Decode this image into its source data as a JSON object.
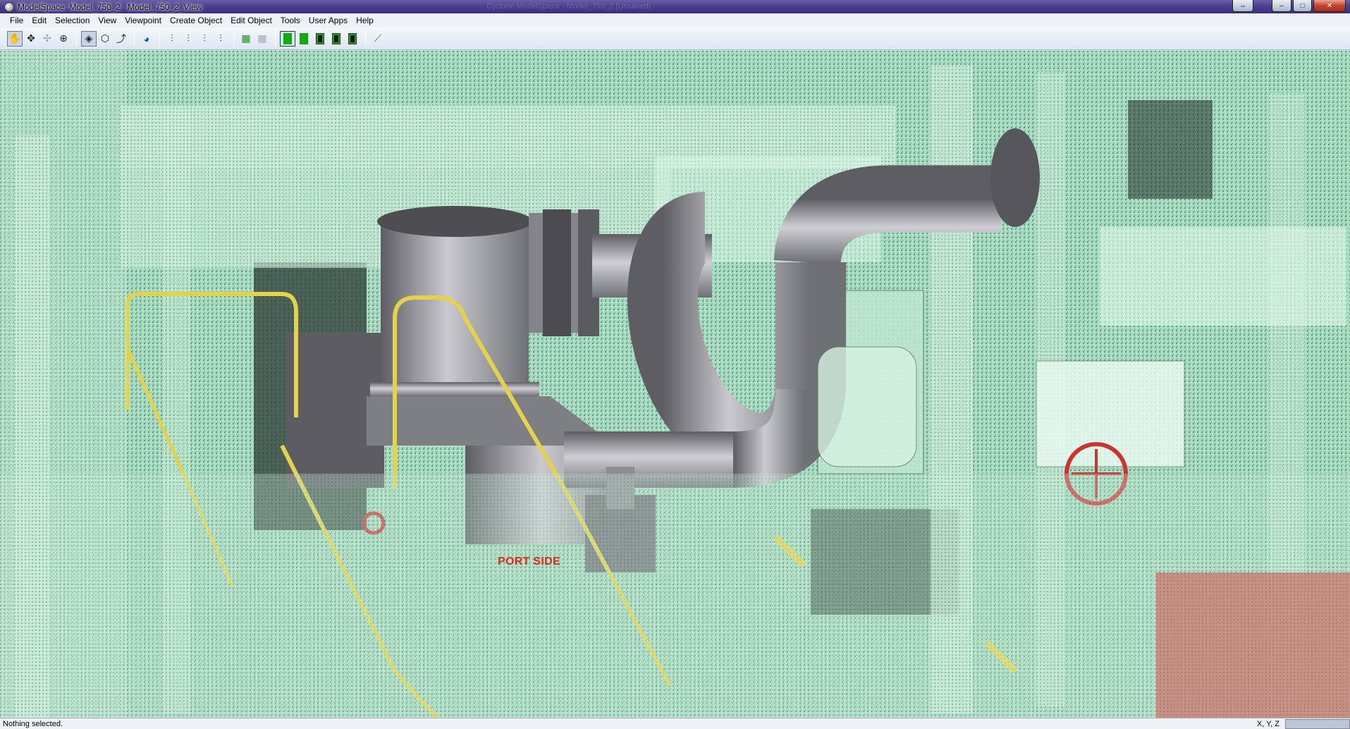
{
  "window": {
    "title": "ModelSpace: Model_750_2 : Model_750_2_View",
    "ghost_text": "Cyclone ModelSpace - Model_750_2 [Unsaved]",
    "buttons": {
      "restore_small": "⇔",
      "minimize": "–",
      "maximize": "□",
      "close": "✕"
    }
  },
  "menu": {
    "items": [
      "File",
      "Edit",
      "Selection",
      "View",
      "Viewpoint",
      "Create Object",
      "Edit Object",
      "Tools",
      "User Apps",
      "Help"
    ]
  },
  "toolbar": {
    "groups": [
      [
        "hand-tool-icon",
        "move-tool-icon",
        "seek-tool-icon",
        "target-tool-icon"
      ],
      [
        "rendered-view-icon",
        "box-view-icon",
        "rotate-axis-icon"
      ],
      [
        "globe-icon"
      ],
      [
        "layer-1-icon",
        "layer-2-icon",
        "layer-3-icon",
        "layer-4-icon"
      ],
      [
        "grid-snap-icon",
        "grid-snap-alt-icon"
      ],
      [
        "green-mode-1-icon",
        "green-mode-2-icon",
        "green-mode-3-icon",
        "green-mode-4-icon",
        "green-mode-5-icon"
      ],
      [
        "measure-tool-icon"
      ]
    ]
  },
  "viewport": {
    "annotation": "PORT SIDE",
    "colors": {
      "annotation": "#e2281d",
      "pipe": "#9a9aa0",
      "cloud": "#9fd9bc"
    }
  },
  "status": {
    "text": "Nothing selected.",
    "coords_label": "X, Y, Z"
  }
}
